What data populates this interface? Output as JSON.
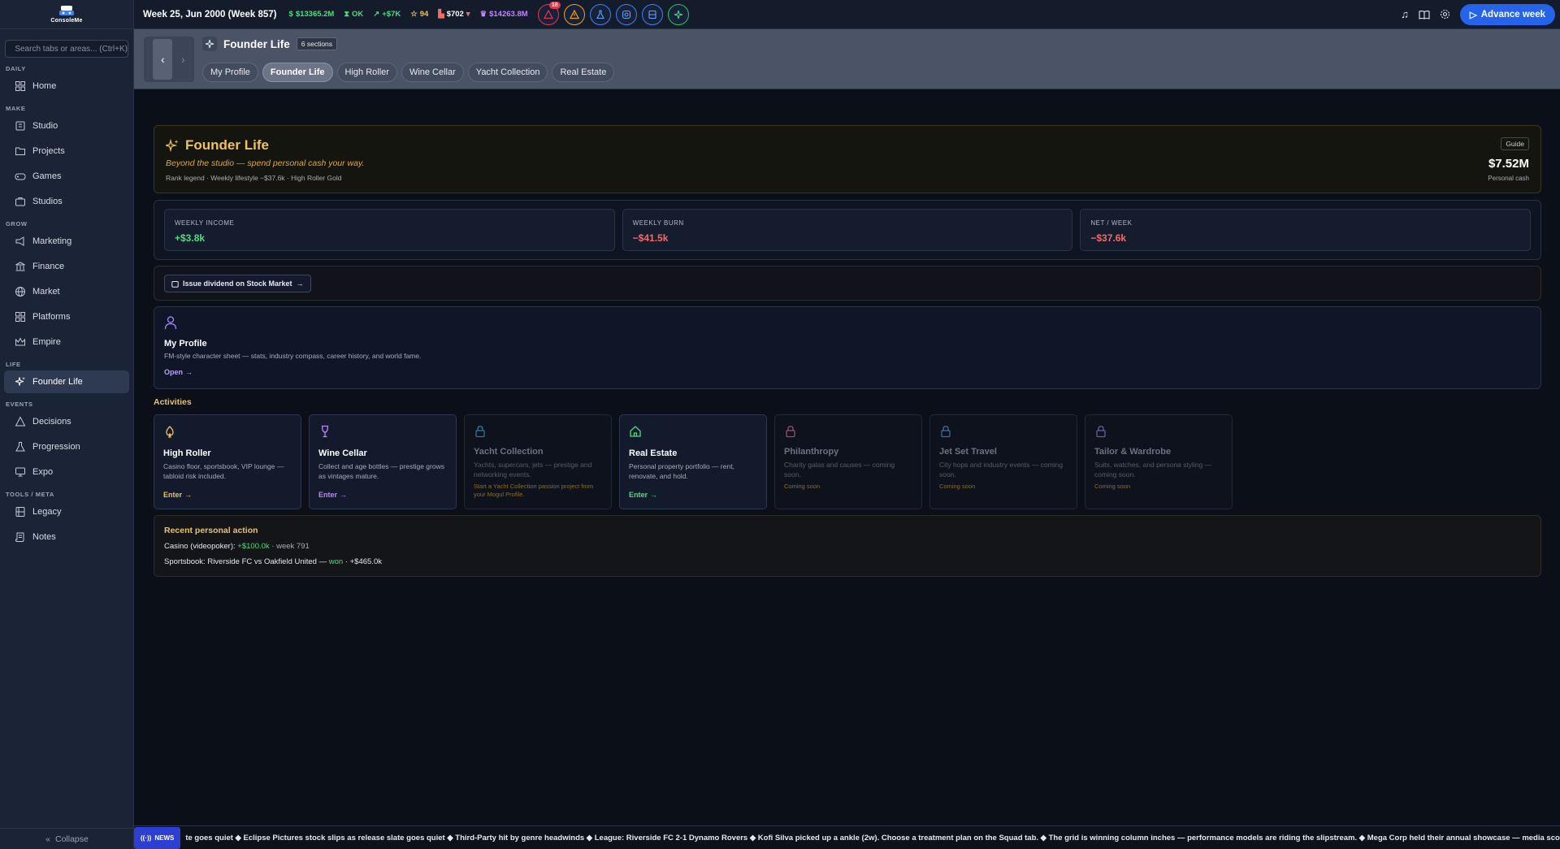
{
  "sidebar": {
    "logo_text": "ConsoleMe",
    "search_placeholder": "Search tabs or areas... (Ctrl+K)",
    "sections": [
      {
        "label": "DAILY",
        "items": [
          {
            "label": "Home",
            "icon": "grid-icon"
          }
        ]
      },
      {
        "label": "MAKE",
        "items": [
          {
            "label": "Studio",
            "icon": "building-icon"
          },
          {
            "label": "Projects",
            "icon": "folder-icon"
          },
          {
            "label": "Games",
            "icon": "gamepad-icon"
          },
          {
            "label": "Studios",
            "icon": "briefcase-icon"
          }
        ]
      },
      {
        "label": "GROW",
        "items": [
          {
            "label": "Marketing",
            "icon": "megaphone-icon"
          },
          {
            "label": "Finance",
            "icon": "bank-icon"
          },
          {
            "label": "Market",
            "icon": "globe-icon"
          },
          {
            "label": "Platforms",
            "icon": "platforms-icon"
          },
          {
            "label": "Empire",
            "icon": "crown-icon"
          }
        ]
      },
      {
        "label": "LIFE",
        "items": [
          {
            "label": "Founder Life",
            "icon": "sparkles-icon",
            "active": true
          }
        ]
      },
      {
        "label": "EVENTS",
        "items": [
          {
            "label": "Decisions",
            "icon": "triangle-icon"
          },
          {
            "label": "Progression",
            "icon": "flask-icon"
          },
          {
            "label": "Expo",
            "icon": "monitor-icon"
          }
        ]
      },
      {
        "label": "TOOLS / META",
        "items": [
          {
            "label": "Legacy",
            "icon": "film-icon"
          },
          {
            "label": "Notes",
            "icon": "scroll-icon"
          }
        ]
      }
    ],
    "collapse_label": "Collapse"
  },
  "topbar": {
    "week_label": "Week 25, Jun 2000 (Week 857)",
    "cash": "$13365.2M",
    "status": "OK",
    "trend": "+$7K",
    "stars": "94",
    "price": "$702",
    "crown_value": "$14263.8M",
    "alert_count": "18",
    "advance_label": "Advance week"
  },
  "header": {
    "title": "Founder Life",
    "sections_badge": "6 sections",
    "tabs": [
      "My Profile",
      "Founder Life",
      "High Roller",
      "Wine Cellar",
      "Yacht Collection",
      "Real Estate"
    ]
  },
  "hero": {
    "title": "Founder Life",
    "subtitle": "Beyond the studio — spend personal cash your way.",
    "meta": "Rank legend · Weekly lifestyle −$37.6k · High Roller Gold",
    "guide_label": "Guide",
    "cash_value": "$7.52M",
    "cash_label": "Personal cash"
  },
  "stats": [
    {
      "label": "WEEKLY INCOME",
      "value": "+$3.8k",
      "color": "#4ade80"
    },
    {
      "label": "WEEKLY BURN",
      "value": "−$41.5k",
      "color": "#f26b6b"
    },
    {
      "label": "NET / WEEK",
      "value": "−$37.6k",
      "color": "#f26b6b"
    }
  ],
  "dividend_button": "Issue dividend on Stock Market",
  "profile": {
    "title": "My Profile",
    "desc": "FM-style character sheet — stats, industry compass, career history, and world fame.",
    "link": "Open"
  },
  "activities_heading": "Activities",
  "activities": [
    {
      "title": "High Roller",
      "desc": "Casino floor, sportsbook, VIP lounge — tabloid risk included.",
      "enter": "Enter",
      "accent": "#f0c25a",
      "icon": "spade-icon",
      "locked": false
    },
    {
      "title": "Wine Cellar",
      "desc": "Collect and age bottles — prestige grows as vintages mature.",
      "enter": "Enter",
      "accent": "#c084fc",
      "icon": "wine-glass-icon",
      "locked": false
    },
    {
      "title": "Yacht Collection",
      "desc": "Yachts, supercars, jets — prestige and networking events.",
      "note": "Start a Yacht Collection passion project from your Mogul Profile.",
      "accent": "#38bdf8",
      "icon": "lock-icon",
      "locked": true
    },
    {
      "title": "Real Estate",
      "desc": "Personal property portfolio — rent, renovate, and hold.",
      "enter": "Enter",
      "accent": "#4ade80",
      "icon": "house-icon",
      "locked": false
    },
    {
      "title": "Philanthropy",
      "desc": "Charity galas and causes — coming soon.",
      "note": "Coming soon",
      "accent": "#f472b6",
      "icon": "lock-icon",
      "locked": true
    },
    {
      "title": "Jet Set Travel",
      "desc": "City hops and industry events — coming soon.",
      "note": "Coming soon",
      "accent": "#60a5fa",
      "icon": "lock-icon",
      "locked": true
    },
    {
      "title": "Tailor & Wardrobe",
      "desc": "Suits, watches, and persona styling — coming soon.",
      "note": "Coming soon",
      "accent": "#a78bfa",
      "icon": "lock-icon",
      "locked": true
    }
  ],
  "recent": {
    "heading": "Recent personal action",
    "line1_prefix": "Casino (videopoker): ",
    "line1_amount": "+$100.0k",
    "line1_suffix": " · week 791",
    "line2_prefix": "Sportsbook: Riverside FC vs Oakfield United — ",
    "line2_result": "won",
    "line2_suffix": " · +$465.0k"
  },
  "ticker": {
    "badge": "NEWS",
    "text": "te goes quiet ◆ Eclipse Pictures stock slips as release slate goes quiet ◆ Third-Party hit by genre headwinds ◆ League: Riverside FC 2-1 Dynamo Rovers ◆ Kofi Silva picked up a ankle (2w). Choose a treatment plan on the Squad tab. ◆ The grid is winning column inches — performance models are riding the slipstream. ◆ Mega Corp held their annual showcase — media score: 67/100 with 6 announc"
  },
  "colors": {
    "gold": "#f0c25a",
    "accent_blue": "#2563eb",
    "positive": "#4ade80",
    "negative": "#f26b6b"
  }
}
